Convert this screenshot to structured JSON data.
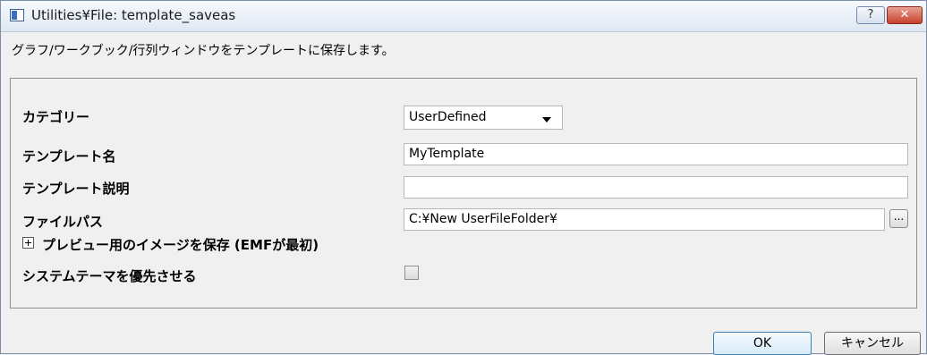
{
  "window": {
    "title": "Utilities¥File: template_saveas",
    "help_label": "?",
    "close_label": "✕"
  },
  "description": "グラフ/ワークブック/行列ウィンドウをテンプレートに保存します。",
  "form": {
    "category": {
      "label": "カテゴリー",
      "value": "UserDefined"
    },
    "template_name": {
      "label": "テンプレート名",
      "value": "MyTemplate"
    },
    "template_description": {
      "label": "テンプレート説明",
      "value": ""
    },
    "file_path": {
      "label": "ファイルパス",
      "value": "C:¥New UserFileFolder¥",
      "browse_label": "..."
    },
    "preview_image": {
      "label": "プレビュー用のイメージを保存 (EMFが最初)",
      "expanded": false
    },
    "system_theme": {
      "label": "システムテーマを優先させる",
      "checked": false
    }
  },
  "buttons": {
    "ok": "OK",
    "cancel": "キャンセル"
  }
}
